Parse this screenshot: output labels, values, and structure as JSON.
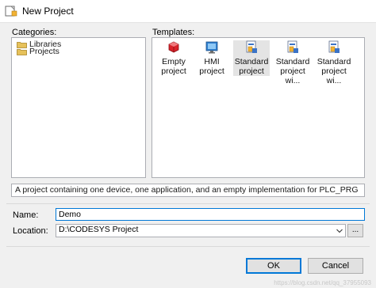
{
  "window": {
    "title": "New Project"
  },
  "categories": {
    "label": "Categories:",
    "items": [
      "Libraries",
      "Projects"
    ]
  },
  "templates": {
    "label": "Templates:",
    "items": [
      {
        "line1": "Empty",
        "line2": "project",
        "icon": "empty-project-icon"
      },
      {
        "line1": "HMI project",
        "line2": "",
        "icon": "hmi-project-icon"
      },
      {
        "line1": "Standard",
        "line2": "project",
        "icon": "standard-project-icon",
        "selected": true
      },
      {
        "line1": "Standard",
        "line2": "project wi...",
        "icon": "standard-project-icon"
      },
      {
        "line1": "Standard",
        "line2": "project wi...",
        "icon": "standard-project-icon"
      }
    ]
  },
  "description": "A project containing one device, one application, and an empty implementation for PLC_PRG",
  "name": {
    "label": "Name:",
    "value": "Demo"
  },
  "location": {
    "label": "Location:",
    "value": "D:\\CODESYS Project",
    "browse_label": "..."
  },
  "buttons": {
    "ok": "OK",
    "cancel": "Cancel"
  },
  "watermark": "https://blog.csdn.net/qq_37955093",
  "colors": {
    "selection": "#e4e4e4",
    "focus_border": "#0078d7",
    "folder": "#e6c15a"
  }
}
